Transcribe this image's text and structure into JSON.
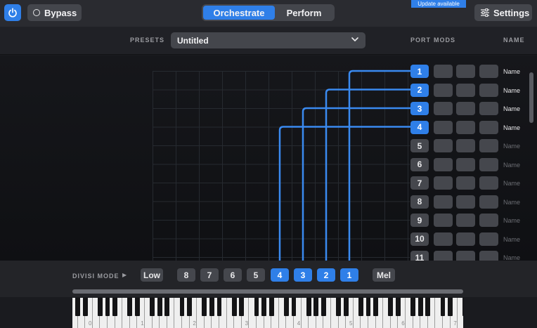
{
  "topbar": {
    "bypass_label": "Bypass",
    "mode_tabs": [
      {
        "label": "Orchestrate",
        "active": true
      },
      {
        "label": "Perform",
        "active": false
      }
    ],
    "update_badge": "Update available",
    "settings_label": "Settings"
  },
  "presets": {
    "label": "PRESETS",
    "value": "Untitled"
  },
  "columns": {
    "port": "PORT",
    "mods": "MODS",
    "name": "NAME"
  },
  "ports": [
    {
      "number": "1",
      "name": "Name",
      "active": true
    },
    {
      "number": "2",
      "name": "Name",
      "active": true
    },
    {
      "number": "3",
      "name": "Name",
      "active": true
    },
    {
      "number": "4",
      "name": "Name",
      "active": true
    },
    {
      "number": "5",
      "name": "Name",
      "active": false
    },
    {
      "number": "6",
      "name": "Name",
      "active": false
    },
    {
      "number": "7",
      "name": "Name",
      "active": false
    },
    {
      "number": "8",
      "name": "Name",
      "active": false
    },
    {
      "number": "9",
      "name": "Name",
      "active": false
    },
    {
      "number": "10",
      "name": "Name",
      "active": false
    },
    {
      "number": "11",
      "name": "Name",
      "active": false
    }
  ],
  "divisi": {
    "label": "DIVISI MODE",
    "buttons": [
      {
        "label": "Low",
        "active": false
      },
      {
        "label": "8",
        "active": false
      },
      {
        "label": "7",
        "active": false
      },
      {
        "label": "6",
        "active": false
      },
      {
        "label": "5",
        "active": false
      },
      {
        "label": "4",
        "active": true
      },
      {
        "label": "3",
        "active": true
      },
      {
        "label": "2",
        "active": true
      },
      {
        "label": "1",
        "active": true
      },
      {
        "label": "Mel",
        "active": false
      }
    ]
  },
  "keyboard": {
    "octave_labels": [
      "0",
      "1",
      "2",
      "3",
      "4",
      "5",
      "6",
      "7"
    ]
  },
  "colors": {
    "accent": "#2f7fe8",
    "button": "#45474d",
    "background": "#1a1b1f"
  }
}
